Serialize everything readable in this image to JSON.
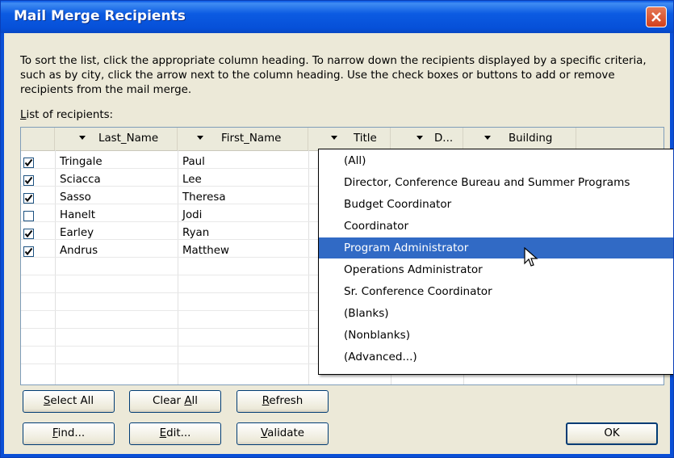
{
  "window": {
    "title": "Mail Merge Recipients"
  },
  "instructions": "To sort the list, click the appropriate column heading.  To narrow down the recipients displayed by a specific criteria, such as by city, click the arrow next to the column heading.  Use the check boxes or buttons to add or remove recipients from the mail merge.",
  "list_label": {
    "accel": "L",
    "rest": "ist of recipients:"
  },
  "columns": [
    "Last_Name",
    "First_Name",
    "Title",
    "D...",
    "Building"
  ],
  "rows": [
    {
      "checked": true,
      "last": "Tringale",
      "first": "Paul"
    },
    {
      "checked": true,
      "last": "Sciacca",
      "first": "Lee"
    },
    {
      "checked": true,
      "last": "Sasso",
      "first": "Theresa"
    },
    {
      "checked": false,
      "last": "Hanelt",
      "first": "Jodi"
    },
    {
      "checked": true,
      "last": "Earley",
      "first": "Ryan"
    },
    {
      "checked": true,
      "last": "Andrus",
      "first": "Matthew"
    }
  ],
  "dropdown_items": [
    "(All)",
    "Director, Conference Bureau and Summer Programs",
    "Budget Coordinator",
    "Coordinator",
    "Program Administrator",
    "Operations Administrator",
    "Sr. Conference Coordinator",
    "(Blanks)",
    "(Nonblanks)",
    "(Advanced...)"
  ],
  "dropdown_selected": "Program Administrator",
  "buttons": {
    "select_all": {
      "accel": "S",
      "rest": "elect All"
    },
    "clear_all": {
      "pre": "Clear ",
      "accel": "A",
      "rest": "ll"
    },
    "refresh": {
      "accel": "R",
      "rest": "efresh"
    },
    "find": {
      "accel": "F",
      "rest": "ind..."
    },
    "edit": {
      "accel": "E",
      "rest": "dit..."
    },
    "validate": {
      "accel": "V",
      "rest": "alidate"
    },
    "ok": "OK"
  },
  "colors": {
    "titlebar": "#0a58e6",
    "selection": "#316ac5",
    "dialog_bg": "#ece9d8"
  }
}
